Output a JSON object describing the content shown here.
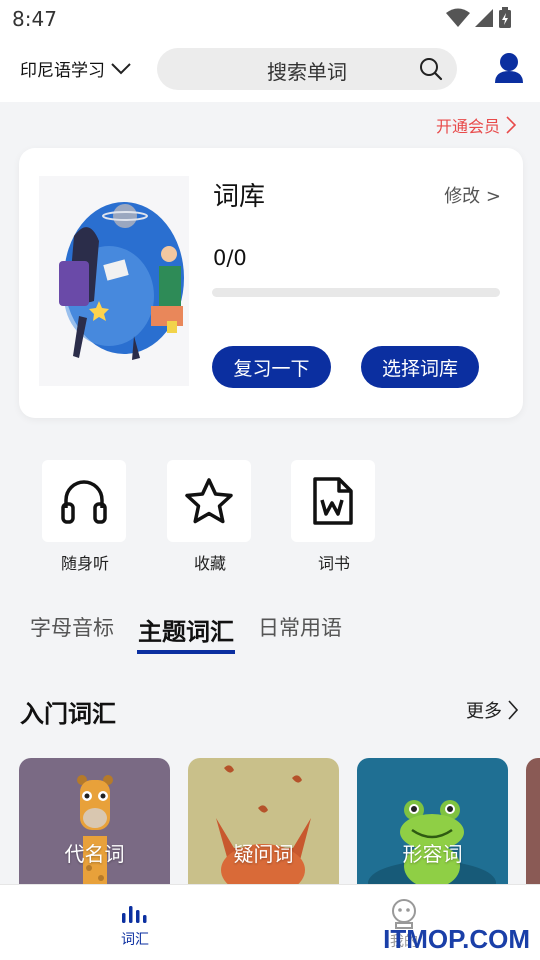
{
  "status": {
    "time": "8:47"
  },
  "header": {
    "language": "印尼语学习",
    "search_placeholder": "搜索单词"
  },
  "vip": {
    "label": "开通会员"
  },
  "book": {
    "title": "词库",
    "edit_label": "修改 >",
    "progress_text": "0/0",
    "progress_fraction": 0,
    "review_button": "复习一下",
    "choose_button": "选择词库"
  },
  "quick_actions": [
    {
      "label": "随身听",
      "icon": "headphones-icon"
    },
    {
      "label": "收藏",
      "icon": "star-icon"
    },
    {
      "label": "词书",
      "icon": "word-document-icon"
    }
  ],
  "tabs": [
    {
      "label": "字母音标",
      "active": false
    },
    {
      "label": "主题词汇",
      "active": true
    },
    {
      "label": "日常用语",
      "active": false
    }
  ],
  "section": {
    "title": "入门词汇",
    "more_label": "更多"
  },
  "topics": [
    {
      "label": "代名词",
      "bg": "#7a6a84",
      "icon": "giraffe-icon"
    },
    {
      "label": "疑问词",
      "bg": "#c9c08a",
      "icon": "fox-icon"
    },
    {
      "label": "形容词",
      "bg": "#1f6f93",
      "icon": "frog-icon"
    }
  ],
  "bottom_nav": [
    {
      "label": "词汇",
      "active": true,
      "icon": "bar-chart-icon"
    },
    {
      "label": "我的",
      "active": false,
      "icon": "robot-face-icon"
    }
  ],
  "watermark": "ITMOP.COM",
  "colors": {
    "primary": "#0b2fa0",
    "vip": "#e84a4a",
    "page_bg": "#f3f4f6"
  }
}
